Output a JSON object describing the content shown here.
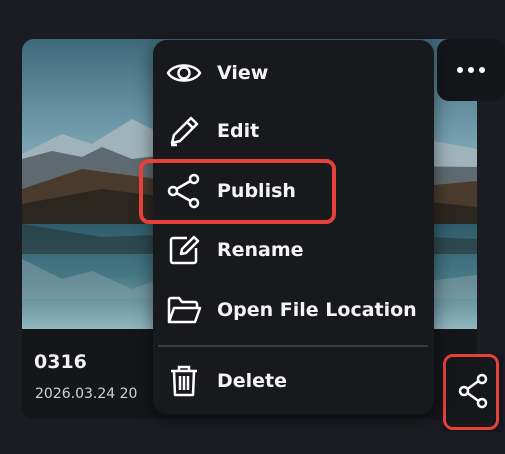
{
  "card": {
    "title": "0316",
    "date": "2026.03.24 20"
  },
  "menu": {
    "items": [
      {
        "label": "View",
        "icon": "eye-icon"
      },
      {
        "label": "Edit",
        "icon": "pencil-icon"
      },
      {
        "label": "Publish",
        "icon": "share-icon"
      },
      {
        "label": "Rename",
        "icon": "rename-icon"
      },
      {
        "label": "Open File Location",
        "icon": "folder-icon"
      },
      {
        "label": "Delete",
        "icon": "trash-icon"
      }
    ]
  },
  "colors": {
    "background": "#1a1c21",
    "menu_bg": "#18191d",
    "highlight": "#e5413a",
    "text": "#f4f4f4"
  }
}
